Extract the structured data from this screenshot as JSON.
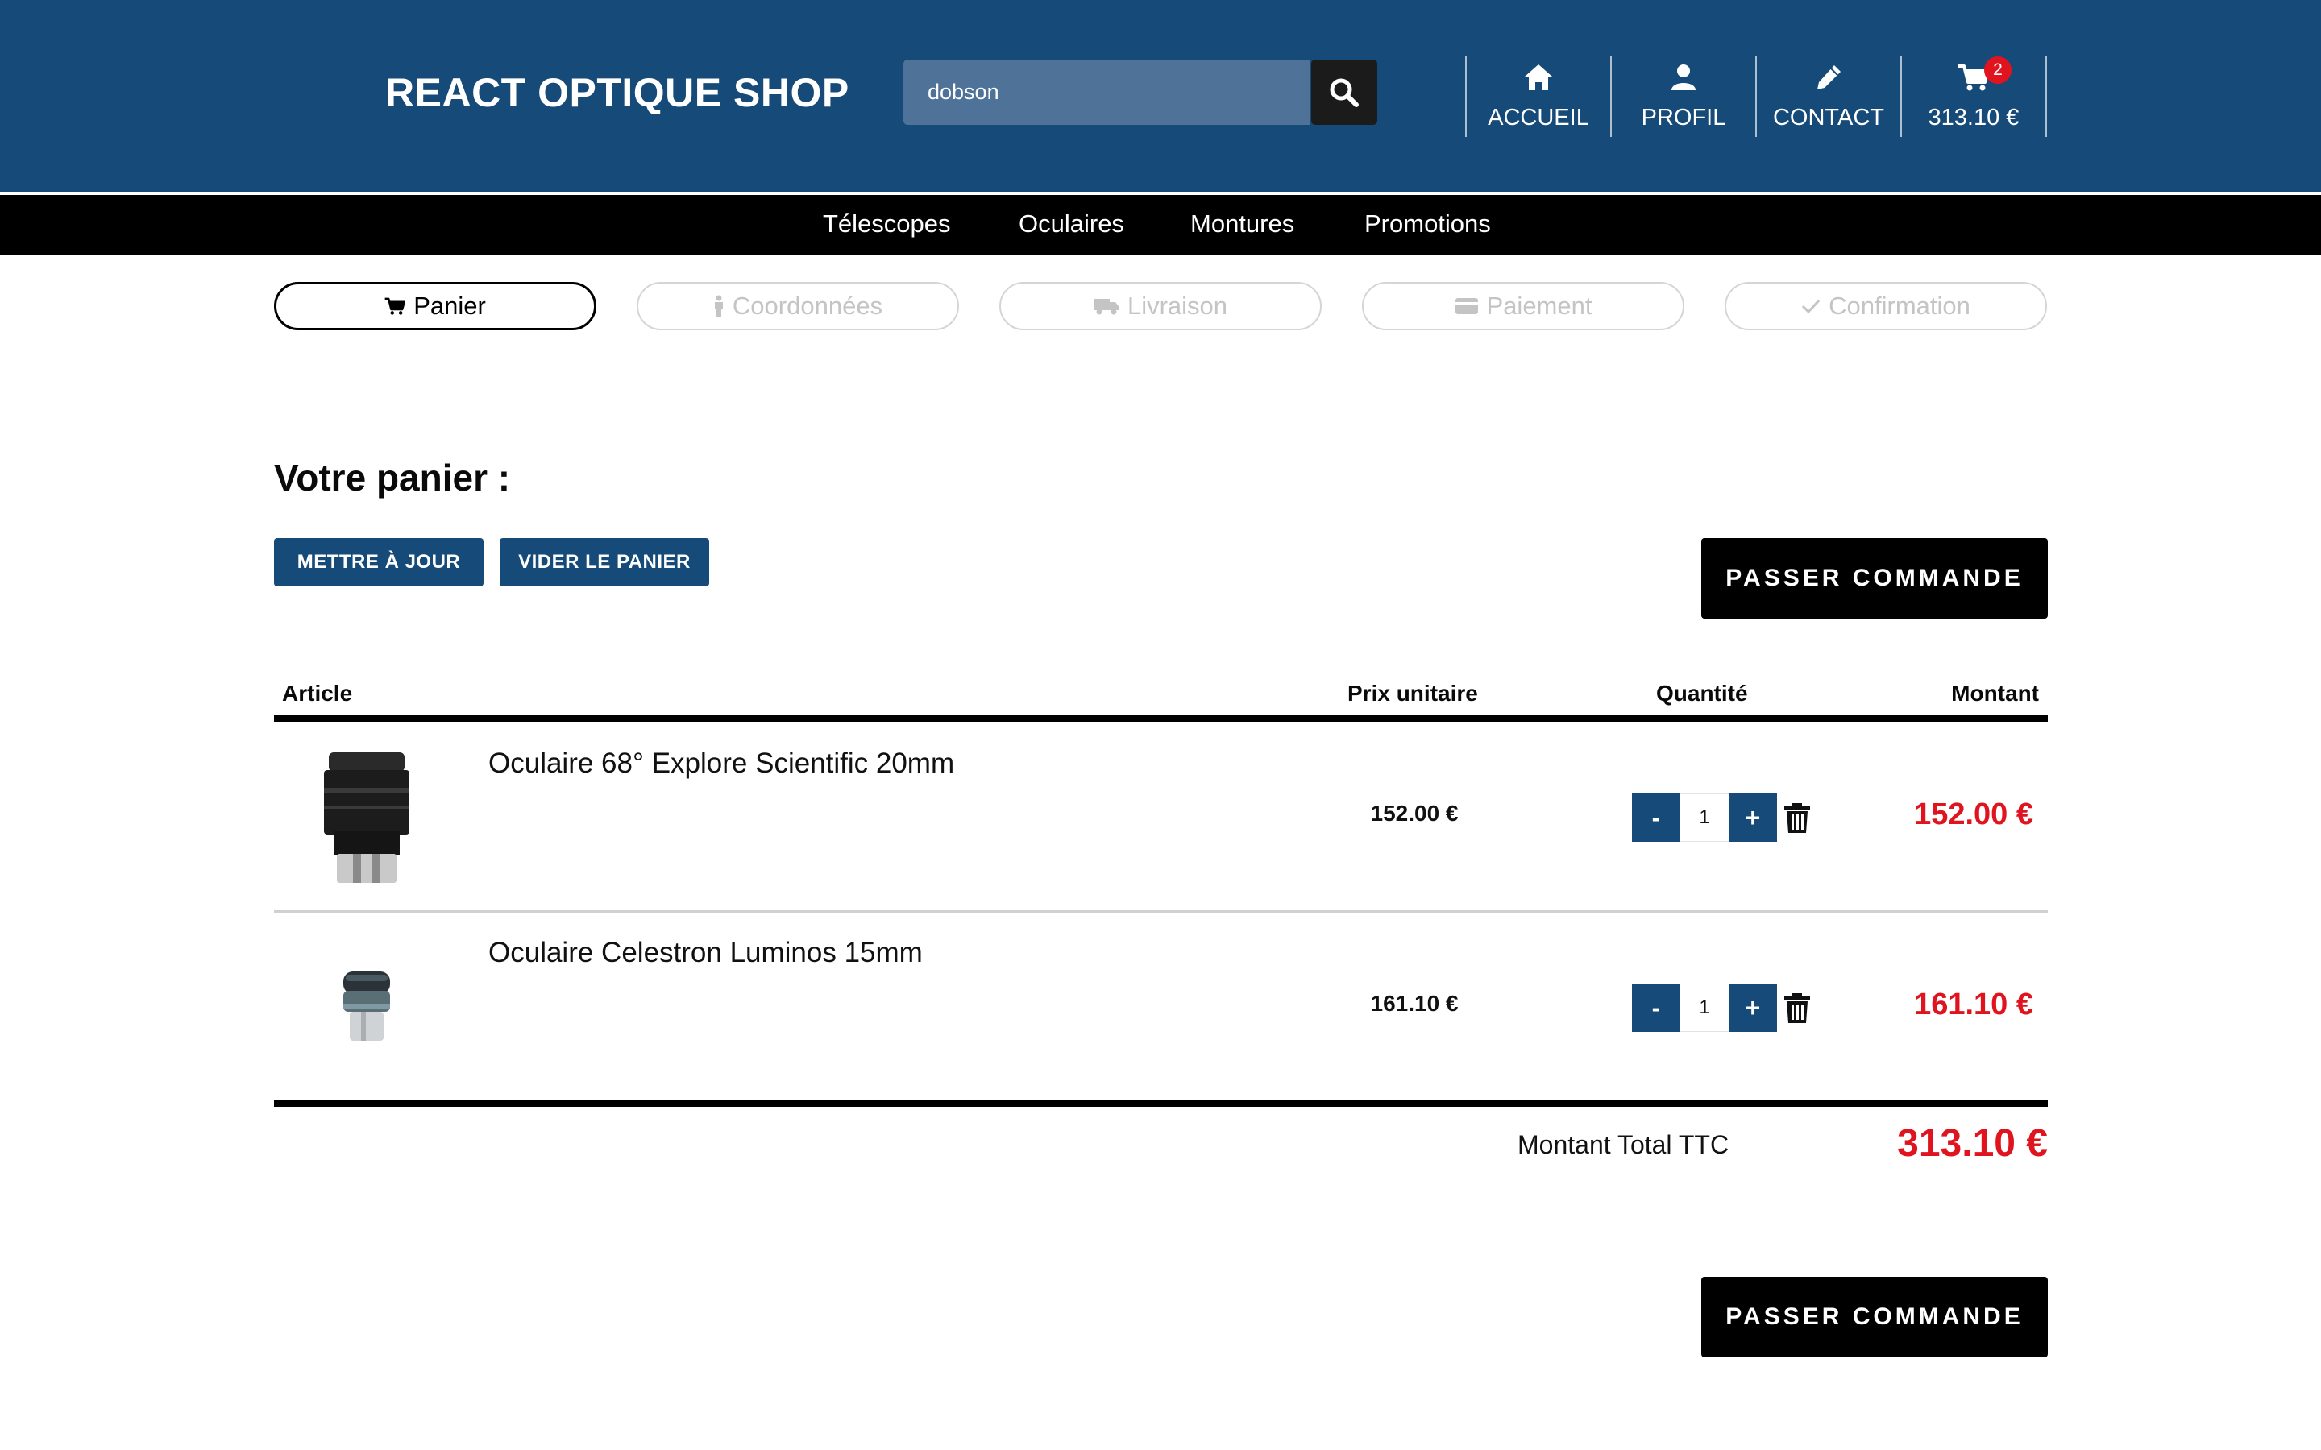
{
  "header": {
    "logo": "REACT OPTIQUE SHOP",
    "search": {
      "value": "dobson",
      "icon": "search-icon"
    },
    "nav": [
      {
        "label": "ACCUEIL",
        "icon": "home-icon"
      },
      {
        "label": "PROFIL",
        "icon": "user-icon"
      },
      {
        "label": "CONTACT",
        "icon": "pencil-icon"
      },
      {
        "label": "313.10 €",
        "icon": "cart-icon",
        "badge": "2"
      }
    ]
  },
  "categories": [
    "Télescopes",
    "Oculaires",
    "Montures",
    "Promotions"
  ],
  "steps": [
    {
      "label": "Panier",
      "icon": "cart-icon",
      "active": true
    },
    {
      "label": "Coordonnées",
      "icon": "person-icon",
      "active": false
    },
    {
      "label": "Livraison",
      "icon": "truck-icon",
      "active": false
    },
    {
      "label": "Paiement",
      "icon": "credit-card-icon",
      "active": false
    },
    {
      "label": "Confirmation",
      "icon": "check-icon",
      "active": false
    }
  ],
  "cart": {
    "title": "Votre panier :",
    "update_label": "METTRE À JOUR",
    "empty_label": "VIDER LE PANIER",
    "checkout_label": "PASSER COMMANDE",
    "columns": [
      "Article",
      "Prix unitaire",
      "Quantité",
      "Montant"
    ],
    "items": [
      {
        "name": "Oculaire 68° Explore Scientific 20mm",
        "unit_price": "152.00 €",
        "qty": "1",
        "minus": "-",
        "plus": "+",
        "amount": "152.00 €"
      },
      {
        "name": "Oculaire Celestron Luminos 15mm",
        "unit_price": "161.10 €",
        "qty": "1",
        "minus": "-",
        "plus": "+",
        "amount": "161.10 €"
      }
    ],
    "total_label": "Montant Total TTC",
    "total_value": "313.10 €"
  },
  "colors": {
    "brand": "#164a78",
    "price": "#e0141e",
    "dark": "#000000"
  }
}
